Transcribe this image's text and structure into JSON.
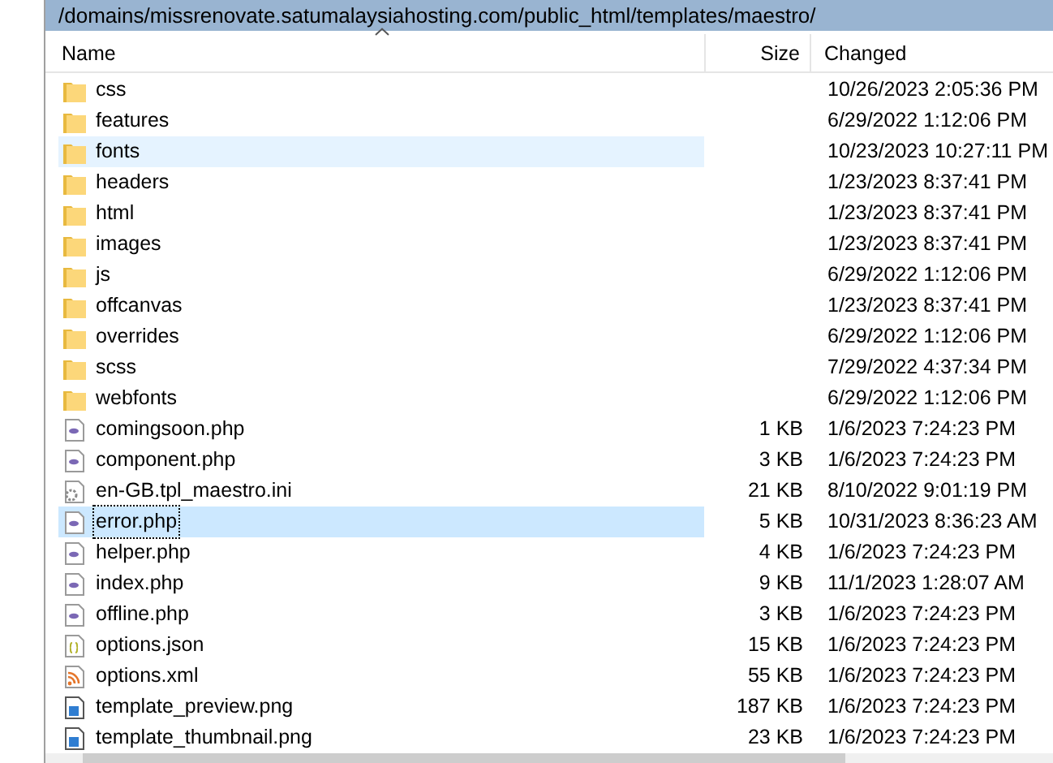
{
  "path_bar": {
    "text": "/domains/missrenovate.satumalaysiahosting.com/public_html/templates/maestro/"
  },
  "columns": [
    {
      "label": "Name",
      "sorted": true
    },
    {
      "label": "Size",
      "sorted": false
    },
    {
      "label": "Changed",
      "sorted": false
    }
  ],
  "rows": [
    {
      "kind": "folder",
      "name": "css",
      "size": "",
      "changed": "10/26/2023 2:05:36 PM",
      "selected": false,
      "hovered": false
    },
    {
      "kind": "folder",
      "name": "features",
      "changed": "6/29/2022 1:12:06 PM",
      "selected": false,
      "hovered": false
    },
    {
      "kind": "folder",
      "name": "fonts",
      "changed": "10/23/2023 10:27:11 PM",
      "selected": false,
      "hovered": true
    },
    {
      "kind": "folder",
      "name": "headers",
      "changed": "1/23/2023 8:37:41 PM",
      "selected": false,
      "hovered": false
    },
    {
      "kind": "folder",
      "name": "html",
      "changed": "1/23/2023 8:37:41 PM",
      "selected": false,
      "hovered": false
    },
    {
      "kind": "folder",
      "name": "images",
      "changed": "1/23/2023 8:37:41 PM",
      "selected": false,
      "hovered": false
    },
    {
      "kind": "folder",
      "name": "js",
      "changed": "6/29/2022 1:12:06 PM",
      "selected": false,
      "hovered": false
    },
    {
      "kind": "folder",
      "name": "offcanvas",
      "changed": "1/23/2023 8:37:41 PM",
      "selected": false,
      "hovered": false
    },
    {
      "kind": "folder",
      "name": "overrides",
      "changed": "6/29/2022 1:12:06 PM",
      "selected": false,
      "hovered": false
    },
    {
      "kind": "folder",
      "name": "scss",
      "changed": "7/29/2022 4:37:34 PM",
      "selected": false,
      "hovered": false
    },
    {
      "kind": "folder",
      "name": "webfonts",
      "changed": "6/29/2022 1:12:06 PM",
      "selected": false,
      "hovered": false
    },
    {
      "kind": "php",
      "name": "comingsoon.php",
      "size": "1 KB",
      "changed": "1/6/2023 7:24:23 PM",
      "selected": false,
      "hovered": false
    },
    {
      "kind": "php",
      "name": "component.php",
      "size": "3 KB",
      "changed": "1/6/2023 7:24:23 PM",
      "selected": false,
      "hovered": false
    },
    {
      "kind": "ini",
      "name": "en-GB.tpl_maestro.ini",
      "size": "21 KB",
      "changed": "8/10/2022 9:01:19 PM",
      "selected": false,
      "hovered": false
    },
    {
      "kind": "php",
      "name": "error.php",
      "size": "5 KB",
      "changed": "10/31/2023 8:36:23 AM",
      "selected": true,
      "hovered": false
    },
    {
      "kind": "php",
      "name": "helper.php",
      "size": "4 KB",
      "changed": "1/6/2023 7:24:23 PM",
      "selected": false,
      "hovered": false
    },
    {
      "kind": "php",
      "name": "index.php",
      "size": "9 KB",
      "changed": "11/1/2023 1:28:07 AM",
      "selected": false,
      "hovered": false
    },
    {
      "kind": "php",
      "name": "offline.php",
      "size": "3 KB",
      "changed": "1/6/2023 7:24:23 PM",
      "selected": false,
      "hovered": false
    },
    {
      "kind": "json",
      "name": "options.json",
      "size": "15 KB",
      "changed": "1/6/2023 7:24:23 PM",
      "selected": false,
      "hovered": false
    },
    {
      "kind": "xml",
      "name": "options.xml",
      "size": "55 KB",
      "changed": "1/6/2023 7:24:23 PM",
      "selected": false,
      "hovered": false
    },
    {
      "kind": "png",
      "name": "template_preview.png",
      "size": "187 KB",
      "changed": "1/6/2023 7:24:23 PM",
      "selected": false,
      "hovered": false
    },
    {
      "kind": "png",
      "name": "template_thumbnail.png",
      "size": "23 KB",
      "changed": "1/6/2023 7:24:23 PM",
      "selected": false,
      "hovered": false
    }
  ]
}
